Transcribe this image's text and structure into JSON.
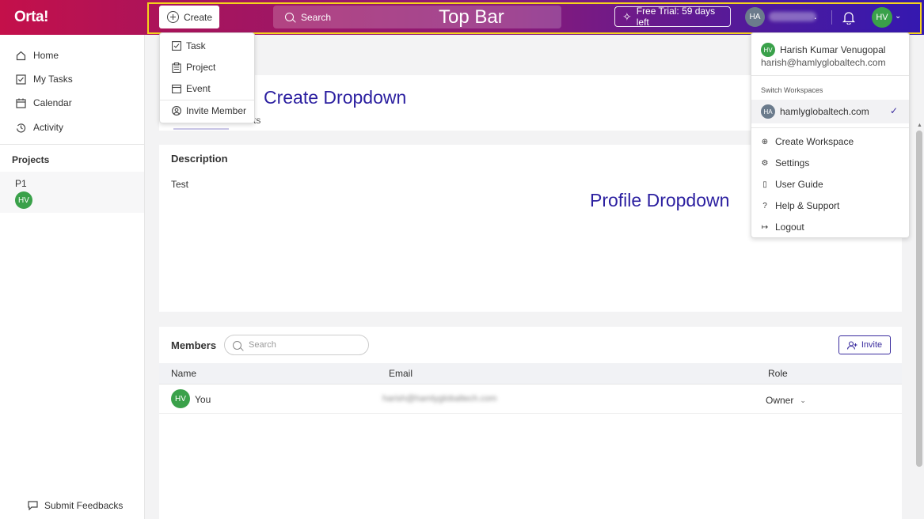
{
  "app": {
    "logo": "Orta!"
  },
  "topbar": {
    "create_label": "Create",
    "search_label": "Search",
    "annotation": "Top Bar",
    "trial_label": "Free Trial: 59 days left",
    "workspace_initials": "HA",
    "workspace_trailing": ".",
    "user_initials": "HV"
  },
  "sidebar": {
    "items": [
      {
        "label": "Home",
        "icon": "home-icon"
      },
      {
        "label": "My Tasks",
        "icon": "checkbox-icon"
      },
      {
        "label": "Calendar",
        "icon": "calendar-icon"
      },
      {
        "label": "Activity",
        "icon": "history-icon"
      }
    ],
    "projects_heading": "Projects",
    "project": {
      "name": "P1",
      "avatar": "HV"
    },
    "feedback_label": "Submit Feedbacks"
  },
  "create_dropdown": {
    "annotation": "Create Dropdown",
    "items": [
      {
        "label": "Task",
        "icon": "checkbox-icon"
      },
      {
        "label": "Project",
        "icon": "clipboard-icon"
      },
      {
        "label": "Event",
        "icon": "calendar-icon"
      },
      {
        "label": "Invite Member",
        "icon": "user-circle-icon"
      }
    ]
  },
  "main": {
    "tab_fragment": "ts",
    "description_title": "Description",
    "description_text": "Test",
    "members_title": "Members",
    "members_search_placeholder": "Search",
    "invite_label": "Invite",
    "columns": {
      "name": "Name",
      "email": "Email",
      "role": "Role"
    },
    "rows": [
      {
        "initials": "HV",
        "name": "You",
        "email": "harish@hamlyglobaltech.com",
        "role": "Owner"
      }
    ]
  },
  "profile_dropdown": {
    "annotation": "Profile Dropdown",
    "initials": "HV",
    "name": "Harish Kumar Venugopal",
    "email": "harish@hamlyglobaltech.com",
    "switch_heading": "Switch Workspaces",
    "workspace": {
      "initials": "HA",
      "name": "hamlyglobaltech.com"
    },
    "items": [
      {
        "label": "Create Workspace",
        "icon": "plus-circle-icon"
      },
      {
        "label": "Settings",
        "icon": "gear-icon"
      },
      {
        "label": "User Guide",
        "icon": "book-icon"
      },
      {
        "label": "Help & Support",
        "icon": "help-icon"
      },
      {
        "label": "Logout",
        "icon": "logout-icon"
      }
    ]
  },
  "colors": {
    "accent": "#3a2c9e",
    "avatar_green": "#3aa14a",
    "topbar_start": "#c4104a",
    "topbar_end": "#3418b0",
    "annotation_yellow": "#f5d21b"
  }
}
